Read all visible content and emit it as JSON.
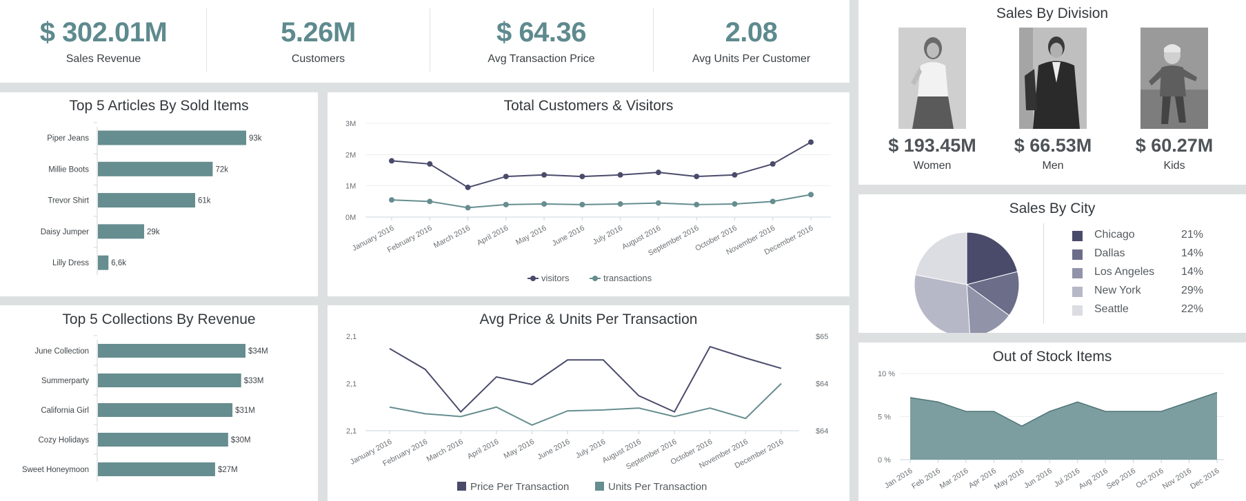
{
  "kpis": [
    {
      "value": "$ 302.01M",
      "label": "Sales Revenue"
    },
    {
      "value": "5.26M",
      "label": "Customers"
    },
    {
      "value": "$ 64.36",
      "label": "Avg Transaction Price"
    },
    {
      "value": "2.08",
      "label": "Avg Units Per Customer"
    }
  ],
  "colors": {
    "teal": "#668d8f",
    "navy": "#4a4b6b",
    "kpi": "#5e8a8e",
    "bg": "#dde0e1"
  },
  "top_articles": {
    "title": "Top 5 Articles By Sold Items"
  },
  "top_collections": {
    "title": "Top 5 Collections By Revenue"
  },
  "customers_visitors": {
    "title": "Total Customers & Visitors"
  },
  "avg_price": {
    "title": "Avg Price & Units Per Transaction"
  },
  "division": {
    "title": "Sales By Division",
    "items": [
      {
        "value": "$ 193.45M",
        "label": "Women",
        "photo": "woman-photo"
      },
      {
        "value": "$ 66.53M",
        "label": "Men",
        "photo": "man-photo"
      },
      {
        "value": "$ 60.27M",
        "label": "Kids",
        "photo": "kid-photo"
      }
    ]
  },
  "city": {
    "title": "Sales By City"
  },
  "stock": {
    "title": "Out of Stock Items"
  },
  "chart_data": [
    {
      "type": "bar",
      "title": "Top 5 Articles By Sold Items",
      "orientation": "horizontal",
      "categories": [
        "Piper Jeans",
        "Millie Boots",
        "Trevor Shirt",
        "Daisy Jumper",
        "Lilly Dress"
      ],
      "values": [
        93000,
        72000,
        61000,
        29000,
        6600
      ],
      "data_labels": [
        "93k",
        "72k",
        "61k",
        "29k",
        "6,6k"
      ],
      "color": "#668d8f"
    },
    {
      "type": "bar",
      "title": "Top 5 Collections By Revenue",
      "orientation": "horizontal",
      "categories": [
        "June Collection",
        "Summerparty",
        "California Girl",
        "Cozy Holidays",
        "Sweet Honeymoon"
      ],
      "values": [
        34,
        33,
        31,
        30,
        27
      ],
      "data_labels": [
        "$34M",
        "$33M",
        "$31M",
        "$30M",
        "$27M"
      ],
      "color": "#668d8f"
    },
    {
      "type": "line",
      "title": "Total Customers & Visitors",
      "categories": [
        "January 2016",
        "February 2016",
        "March 2016",
        "April 2016",
        "May 2016",
        "June 2016",
        "July 2016",
        "August 2016",
        "September 2016",
        "October 2016",
        "November 2016",
        "December 2016"
      ],
      "y_ticks": [
        "0M",
        "1M",
        "2M",
        "3M"
      ],
      "ylim": [
        0,
        3
      ],
      "legend": "bottom",
      "grid": true,
      "series": [
        {
          "name": "visitors",
          "color": "#4a4b6b",
          "values": [
            1.8,
            1.7,
            0.95,
            1.3,
            1.35,
            1.3,
            1.35,
            1.43,
            1.3,
            1.35,
            1.7,
            2.4
          ]
        },
        {
          "name": "transactions",
          "color": "#668d8f",
          "values": [
            0.55,
            0.5,
            0.3,
            0.4,
            0.42,
            0.4,
            0.42,
            0.45,
            0.4,
            0.42,
            0.5,
            0.72
          ]
        }
      ]
    },
    {
      "type": "line",
      "title": "Avg Price & Units Per Transaction",
      "categories": [
        "January 2016",
        "February 2016",
        "March 2016",
        "April 2016",
        "May 2016",
        "June 2016",
        "July 2016",
        "August 2016",
        "September 2016",
        "October 2016",
        "November 2016",
        "December 2016"
      ],
      "y_ticks_left": [
        "2,1",
        "2,1",
        "2,1"
      ],
      "y_ticks_right": [
        "$64",
        "$64",
        "$65"
      ],
      "legend": "bottom",
      "series": [
        {
          "name": "Price Per Transaction",
          "color": "#4a4b6b",
          "values": [
            0.87,
            0.65,
            0.2,
            0.57,
            0.49,
            0.75,
            0.75,
            0.37,
            0.2,
            0.89,
            0.77,
            0.66
          ]
        },
        {
          "name": "Units Per Transaction",
          "color": "#668d8f",
          "values": [
            0.25,
            0.18,
            0.15,
            0.25,
            0.06,
            0.21,
            0.22,
            0.24,
            0.15,
            0.24,
            0.13,
            0.5
          ]
        }
      ]
    },
    {
      "type": "pie",
      "title": "Sales By City",
      "legend": "right",
      "slices": [
        {
          "label": "Chicago",
          "value": 21,
          "display": "21%",
          "color": "#4a4b6b"
        },
        {
          "label": "Dallas",
          "value": 14,
          "display": "14%",
          "color": "#6b6d89"
        },
        {
          "label": "Los Angeles",
          "value": 14,
          "display": "14%",
          "color": "#9193a8"
        },
        {
          "label": "New York",
          "value": 29,
          "display": "29%",
          "color": "#b7b8c7"
        },
        {
          "label": "Seattle",
          "value": 22,
          "display": "22%",
          "color": "#dcdce3"
        }
      ]
    },
    {
      "type": "area",
      "title": "Out of Stock Items",
      "categories": [
        "Jan 2016",
        "Feb 2016",
        "Mar 2016",
        "Apr 2016",
        "May 2016",
        "Jun 2016",
        "Jul 2016",
        "Aug 2016",
        "Sep 2016",
        "Oct 2016",
        "Nov 2016",
        "Dec 2016"
      ],
      "y_ticks": [
        "0 %",
        "5 %",
        "10 %"
      ],
      "ylim": [
        0,
        10
      ],
      "values": [
        7.2,
        6.7,
        5.6,
        5.6,
        3.9,
        5.6,
        6.7,
        5.6,
        5.6,
        5.6,
        6.7,
        7.8
      ],
      "color": "#668d8f"
    }
  ]
}
